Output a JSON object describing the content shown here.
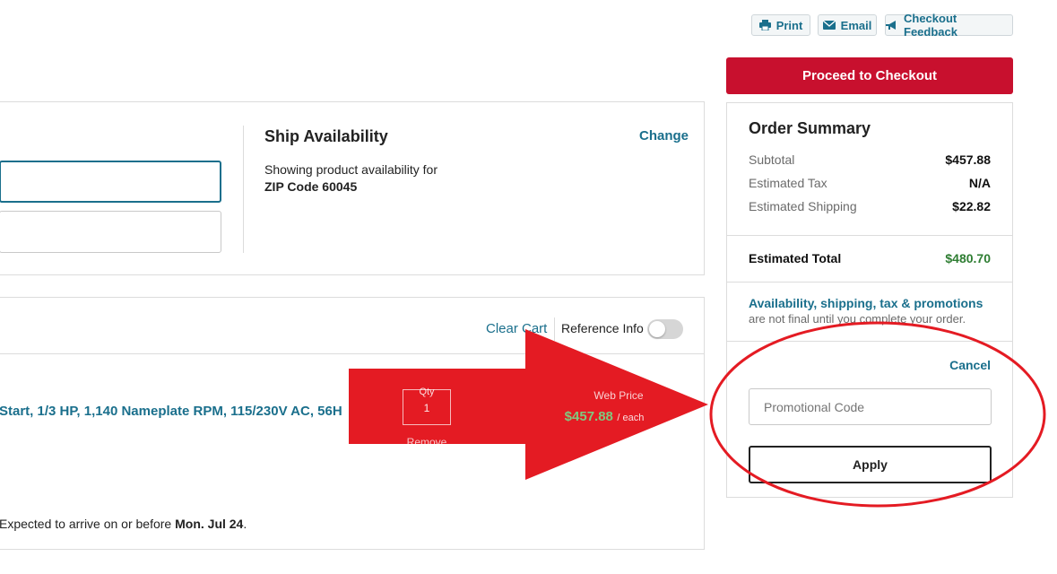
{
  "toolbar": {
    "print_label": "Print",
    "email_label": "Email",
    "feedback_label": "Checkout Feedback",
    "checkout_label": "Proceed to Checkout"
  },
  "ship": {
    "title": "Ship Availability",
    "change_label": "Change",
    "showing_text": "Showing product availability for",
    "zip_text": "ZIP Code 60045"
  },
  "cart": {
    "clear_label": "Clear Cart",
    "reference_label": "Reference Info",
    "reference_on": false,
    "item": {
      "title": "Start, 1/3 HP, 1,140 Nameplate RPM, 115/230V AC, 56H",
      "qty_label": "Qty",
      "qty_value": "1",
      "remove_label": "Remove",
      "price_label": "Web Price",
      "price_value": "$457.88",
      "price_unit": "/ each",
      "delivery_prefix": "Expected to arrive on or before ",
      "delivery_date": "Mon. Jul 24",
      "delivery_suffix": "."
    }
  },
  "summary": {
    "title": "Order Summary",
    "subtotal_label": "Subtotal",
    "subtotal_value": "$457.88",
    "tax_label": "Estimated Tax",
    "tax_value": "N/A",
    "shipping_label": "Estimated Shipping",
    "shipping_value": "$22.82",
    "total_label": "Estimated Total",
    "total_value": "$480.70",
    "notice_link": "Availability, shipping, tax & promotions",
    "notice_rest": " are not final until you complete your order."
  },
  "promo": {
    "cancel_label": "Cancel",
    "placeholder": "Promotional Code",
    "apply_label": "Apply"
  },
  "colors": {
    "brand_red": "#c8102e",
    "link_blue": "#1a6f8c",
    "total_green": "#2e7d32",
    "annotation_red": "#e41b23"
  },
  "icons": [
    "printer-icon",
    "envelope-icon",
    "megaphone-icon"
  ]
}
